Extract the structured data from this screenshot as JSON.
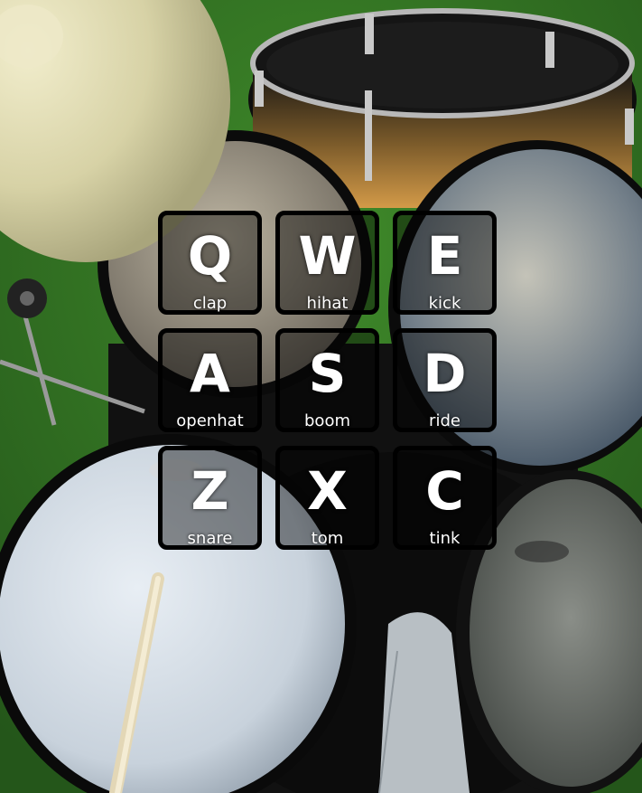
{
  "pads": [
    {
      "key": "Q",
      "sound": "clap"
    },
    {
      "key": "W",
      "sound": "hihat"
    },
    {
      "key": "E",
      "sound": "kick"
    },
    {
      "key": "A",
      "sound": "openhat"
    },
    {
      "key": "S",
      "sound": "boom"
    },
    {
      "key": "D",
      "sound": "ride"
    },
    {
      "key": "Z",
      "sound": "snare"
    },
    {
      "key": "X",
      "sound": "tom"
    },
    {
      "key": "C",
      "sound": "tink"
    }
  ],
  "colors": {
    "pad_border": "#000000",
    "pad_text": "#ffffff",
    "floor_green": "#2f6a1d"
  }
}
